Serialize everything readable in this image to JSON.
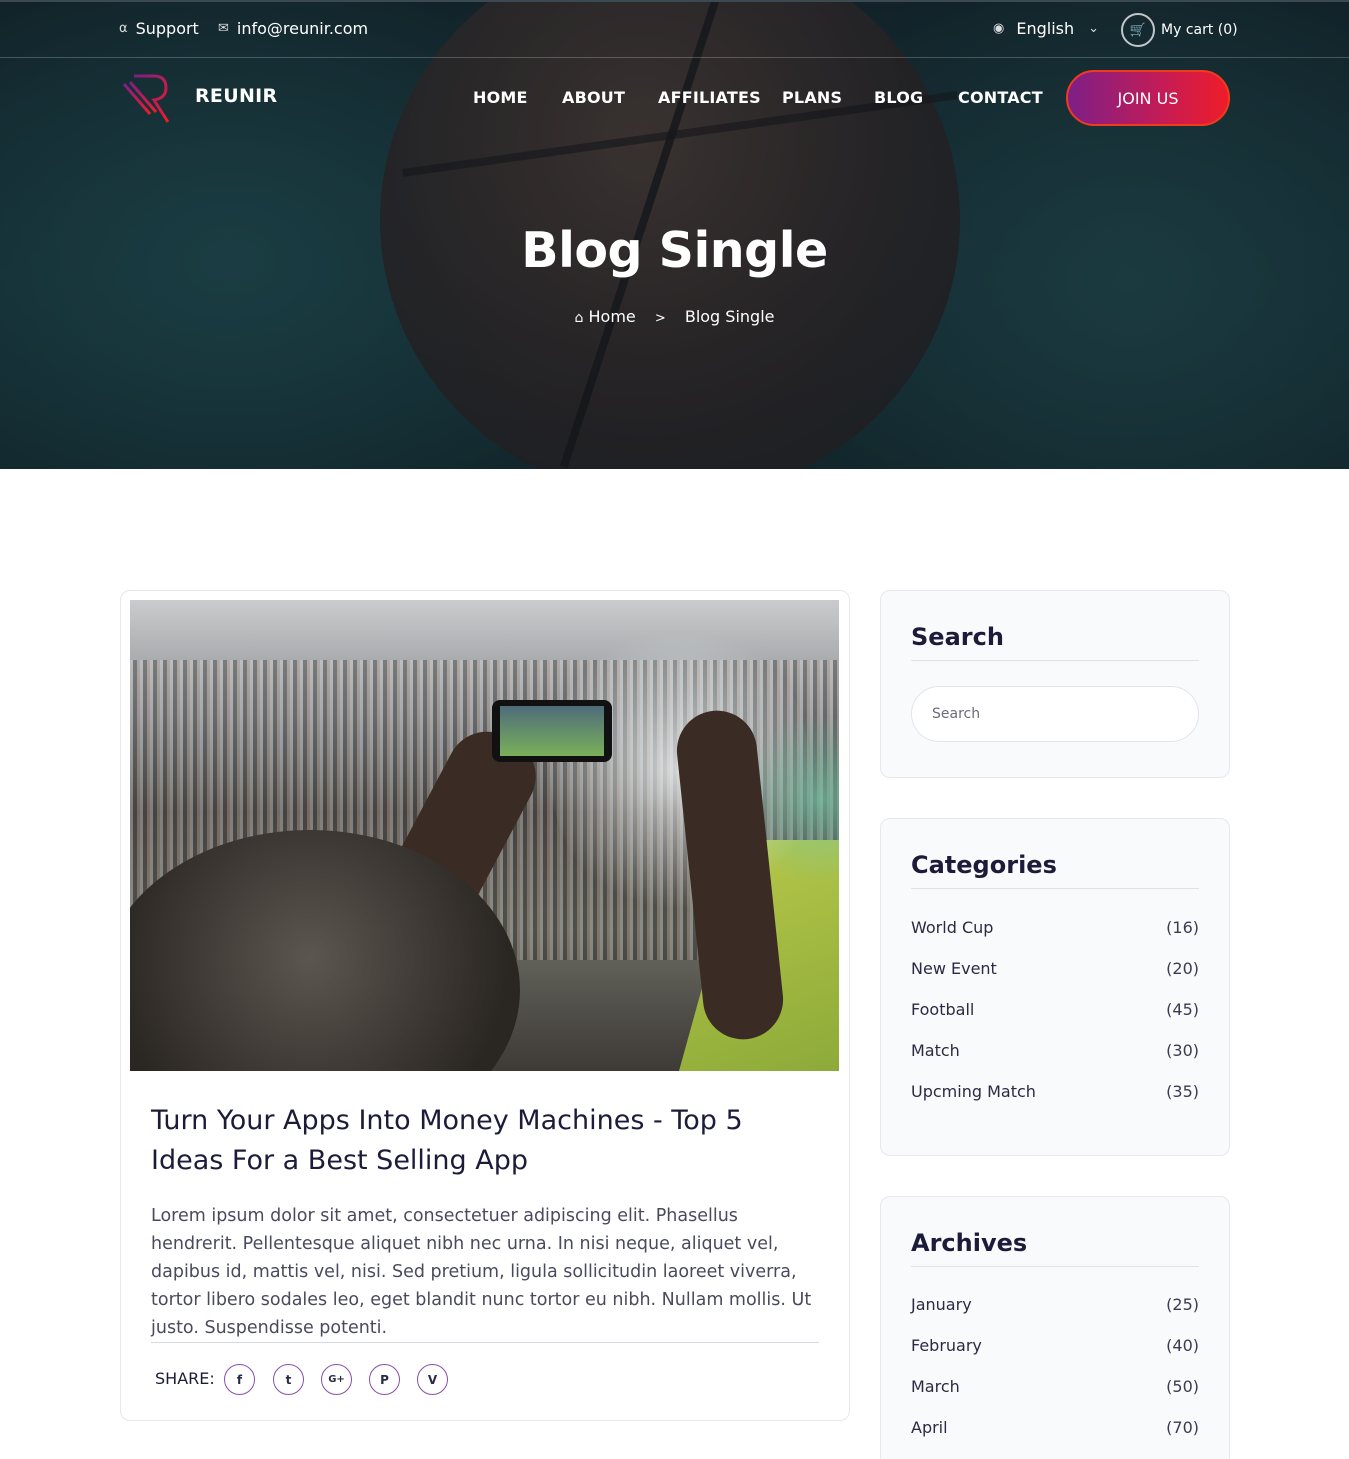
{
  "topbar": {
    "support": "Support",
    "email": "info@reunir.com",
    "language": "English",
    "cart": "My cart (0)"
  },
  "brand": {
    "name": "REUNIR"
  },
  "nav": {
    "items": [
      "HOME",
      "ABOUT",
      "AFFILIATES",
      "PLANS",
      "BLOG",
      "CONTACT"
    ],
    "join": "JOIN US"
  },
  "hero": {
    "title": "Blog Single",
    "breadcrumb_home": "Home",
    "breadcrumb_sep": ">",
    "breadcrumb_current": "Blog Single"
  },
  "post": {
    "title": "Turn Your Apps Into Money Machines - Top 5 Ideas For a Best Selling App",
    "body": "Lorem ipsum dolor sit amet, consectetuer adipiscing elit. Phasellus hendrerit. Pellentesque aliquet nibh nec urna. In nisi neque, aliquet vel, dapibus id, mattis vel, nisi. Sed pretium, ligula sollicitudin laoreet viverra, tortor libero sodales leo, eget blandit nunc tortor eu nibh. Nullam mollis. Ut justo. Suspendisse potenti.",
    "share_label": "SHARE:",
    "share_icons": [
      "f",
      "t",
      "G+",
      "P",
      "V"
    ]
  },
  "search": {
    "title": "Search",
    "placeholder": "Search"
  },
  "categories": {
    "title": "Categories",
    "items": [
      {
        "label": "World Cup",
        "count": "(16)"
      },
      {
        "label": "New Event",
        "count": "(20)"
      },
      {
        "label": "Football",
        "count": "(45)"
      },
      {
        "label": "Match",
        "count": "(30)"
      },
      {
        "label": "Upcming Match",
        "count": "(35)"
      }
    ]
  },
  "archives": {
    "title": "Archives",
    "items": [
      {
        "label": "January",
        "count": "(25)"
      },
      {
        "label": "February",
        "count": "(40)"
      },
      {
        "label": "March",
        "count": "(50)"
      },
      {
        "label": "April",
        "count": "(70)"
      }
    ]
  },
  "colors": {
    "accent_start": "#7d1f86",
    "accent_end": "#ef1c2a",
    "heading": "#1c1c3a"
  }
}
